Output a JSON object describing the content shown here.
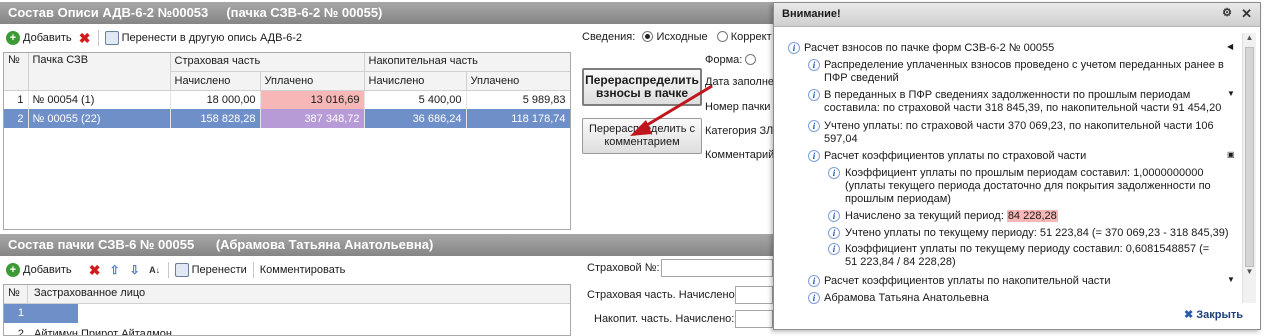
{
  "top_window": {
    "title": "Состав Описи АДВ-6-2 №00053     (пачка СЗВ-6-2 № 00055)",
    "toolbar": {
      "add": "Добавить",
      "move": "Перенести в другую опись АДВ-6-2"
    },
    "table": {
      "headers": {
        "num": "№",
        "pack": "Пачка СЗВ",
        "insurance": "Страховая часть",
        "accumulative": "Накопительная часть",
        "accrued": "Начислено",
        "paid": "Уплачено"
      },
      "rows": [
        {
          "num": "1",
          "pack": "№ 00054 (1)",
          "ins_accrued": "18 000,00",
          "ins_paid": "13 016,69",
          "acc_accrued": "5 400,00",
          "acc_paid": "5 989,83"
        },
        {
          "num": "2",
          "pack": "№ 00055 (22)",
          "ins_accrued": "158 828,28",
          "ins_paid": "387 348,72",
          "acc_accrued": "36 686,24",
          "acc_paid": "118 178,74"
        }
      ]
    },
    "info": {
      "label": "Сведения:",
      "opt1": "Исходные",
      "opt2": "Коррект"
    },
    "form_label": "Форма:",
    "side_labels": [
      "Дата заполне",
      "Номер пачки",
      "Категория ЗЛ",
      "Комментарий"
    ],
    "buttons": {
      "redistribute": "Перераспределить взносы в пачке",
      "redistribute_comment": "Перераспределить с комментарием"
    }
  },
  "bottom_window": {
    "title": "Состав пачки СЗВ-6 № 00055      (Абрамова Татьяна Анатольевна)",
    "toolbar": {
      "add": "Добавить",
      "move": "Перенести",
      "comment": "Комментировать"
    },
    "table": {
      "num": "№",
      "person": "Застрахованное лицо",
      "row1_num": "1",
      "row2_num": "2",
      "row2_name": "Айтимун Прирот Айтадмон"
    },
    "fields": {
      "ins_no": "Страховой №:",
      "ins_accrued": "Страховая часть. Начислено:",
      "acc_accrued": "Накопит. часть. Начислено:"
    }
  },
  "notice_panel": {
    "title": "Внимание!",
    "messages": {
      "m1": "Расчет взносов по пачке форм СЗВ-6-2 № 00055",
      "m2": "Распределение уплаченных взносов проведено с учетом переданных ранее в ПФР сведений",
      "m3": "В переданных в ПФР сведениях задолженности по прошлым периодам составила: по страховой части 318 845,39, по накопительной части 91 454,20",
      "m4": "Учтено уплаты: по страховой части 370 069,23, по накопительной части 106 597,04",
      "m5": "Расчет коэффициентов уплаты по страховой части",
      "m6": "Коэффициент уплаты по прошлым периодам составил: 1,0000000000 (уплаты текущего периода достаточно для покрытия задолженности по прошлым периодам)",
      "m7_prefix": "Начислено за текущий период: ",
      "m7_value": "84 228,28",
      "m8": "Учтено уплаты по текущему периоду: 51 223,84 (= 370 069,23 - 318 845,39)",
      "m9": "Коэффициент уплаты по текущему периоду составил: 0,6081548857 (= 51 223,84 / 84 228,28)",
      "m10": "Расчет коэффициентов уплаты по накопительной части",
      "m11": "Абрамова Татьяна Анатольевна"
    },
    "close": "Закрыть"
  },
  "colors": {
    "title_bar": "#858585",
    "selection": "#6f8fc8",
    "highlight": "#f7b7b7",
    "arrow": "#c0151b"
  }
}
